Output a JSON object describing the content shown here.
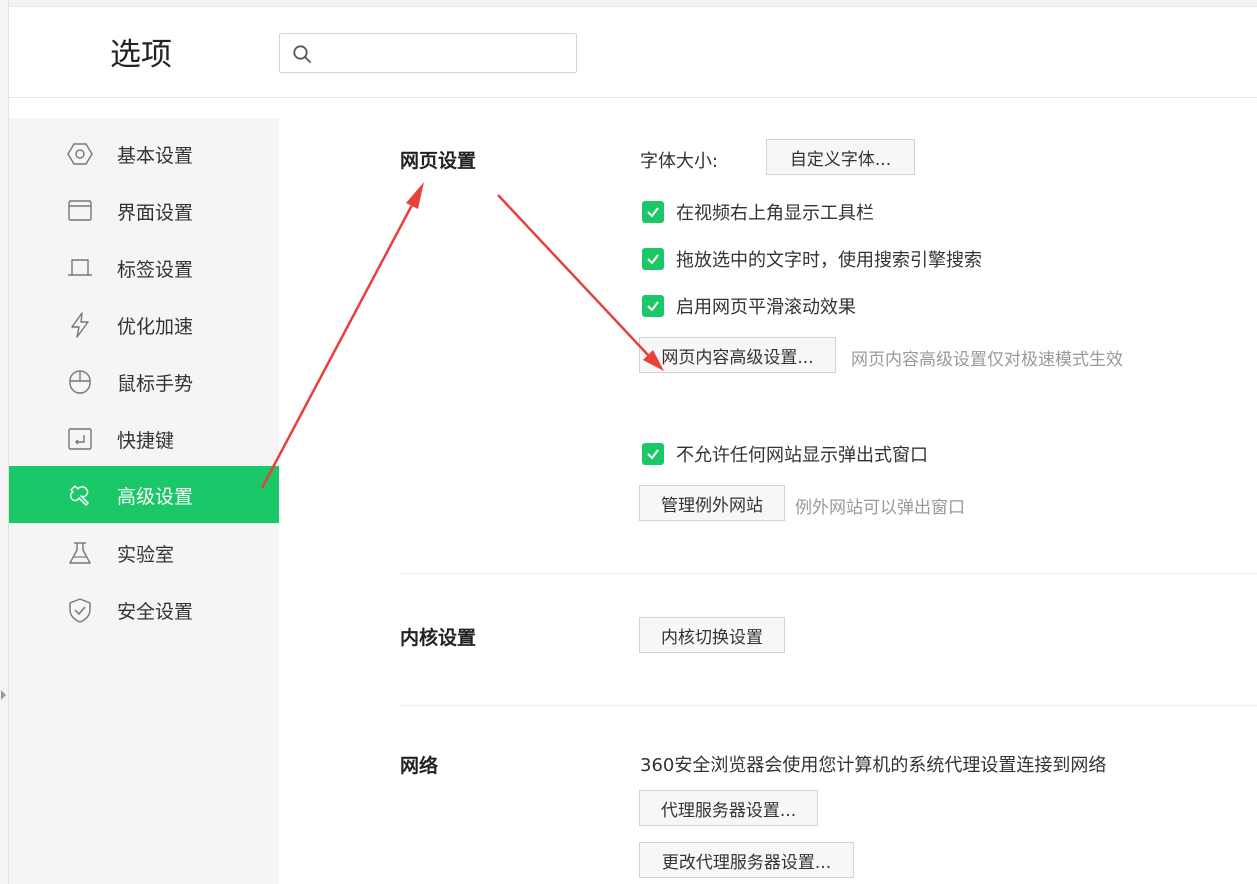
{
  "header": {
    "title": "选项",
    "search": {
      "placeholder": "",
      "value": ""
    }
  },
  "sidebar": {
    "items": [
      {
        "label": "基本设置",
        "icon": "hexagon-settings-icon",
        "active": false
      },
      {
        "label": "界面设置",
        "icon": "window-icon",
        "active": false
      },
      {
        "label": "标签设置",
        "icon": "tab-icon",
        "active": false
      },
      {
        "label": "优化加速",
        "icon": "lightning-icon",
        "active": false
      },
      {
        "label": "鼠标手势",
        "icon": "mouse-icon",
        "active": false
      },
      {
        "label": "快捷键",
        "icon": "keyboard-enter-icon",
        "active": false
      },
      {
        "label": "高级设置",
        "icon": "wrench-icon",
        "active": true
      },
      {
        "label": "实验室",
        "icon": "flask-icon",
        "active": false
      },
      {
        "label": "安全设置",
        "icon": "shield-check-icon",
        "active": false
      }
    ]
  },
  "main": {
    "web": {
      "title": "网页设置",
      "font_size_label": "字体大小:",
      "custom_font_button": "自定义字体...",
      "checks": [
        "在视频右上角显示工具栏",
        "拖放选中的文字时，使用搜索引擎搜索",
        "启用网页平滑滚动效果"
      ],
      "advanced_button": "网页内容高级设置...",
      "advanced_hint": "网页内容高级设置仅对极速模式生效",
      "popup_check": "不允许任何网站显示弹出式窗口",
      "exceptions_button": "管理例外网站",
      "exceptions_hint": "例外网站可以弹出窗口"
    },
    "kernel": {
      "title": "内核设置",
      "switch_button": "内核切换设置"
    },
    "network": {
      "title": "网络",
      "description": "360安全浏览器会使用您计算机的系统代理设置连接到网络",
      "proxy_button": "代理服务器设置...",
      "change_proxy_button": "更改代理服务器设置..."
    }
  },
  "colors": {
    "accent": "#1bc868",
    "annotation_arrow": "#e8403a"
  }
}
